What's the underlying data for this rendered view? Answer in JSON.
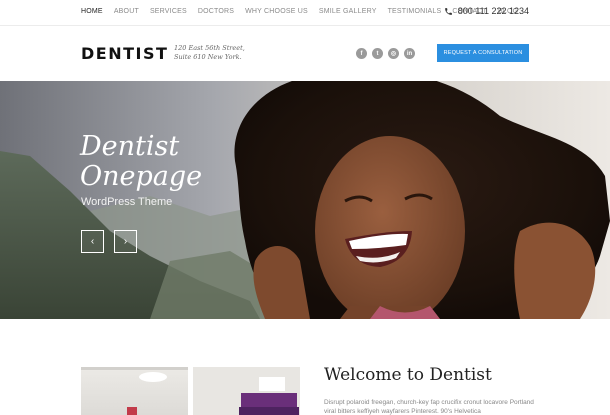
{
  "topnav": {
    "items": [
      {
        "label": "HOME"
      },
      {
        "label": "ABOUT"
      },
      {
        "label": "SERVICES"
      },
      {
        "label": "DOCTORS"
      },
      {
        "label": "WHY CHOOSE US"
      },
      {
        "label": "SMILE GALLERY"
      },
      {
        "label": "TESTIMONIALS"
      },
      {
        "label": "CONTACT"
      },
      {
        "label": "BLOG"
      }
    ],
    "phone": "800 111 222 1234"
  },
  "header": {
    "logo": "DENTIST",
    "address_line1": "120 East 56th Street,",
    "address_line2": "Suite 610 New York.",
    "socials": [
      {
        "icon": "facebook-icon",
        "glyph": "f"
      },
      {
        "icon": "twitter-icon",
        "glyph": "t"
      },
      {
        "icon": "dribbble-icon",
        "glyph": "◎"
      },
      {
        "icon": "linkedin-icon",
        "glyph": "in"
      }
    ],
    "cta_label": "REQUEST A CONSULTATION"
  },
  "hero": {
    "title_line1": "Dentist",
    "title_line2": "Onepage",
    "subtitle": "WordPress Theme",
    "prev_glyph": "‹",
    "next_glyph": "›"
  },
  "welcome": {
    "title": "Welcome to Dentist",
    "text": "Disrupt polaroid freegan, church-key fap crucifix cronut locavore Portland viral bitters keffiyeh wayfarers Pinterest. 90's Helvetica"
  },
  "colors": {
    "accent": "#2b8fe0",
    "social_gray": "#9a9a9a"
  }
}
